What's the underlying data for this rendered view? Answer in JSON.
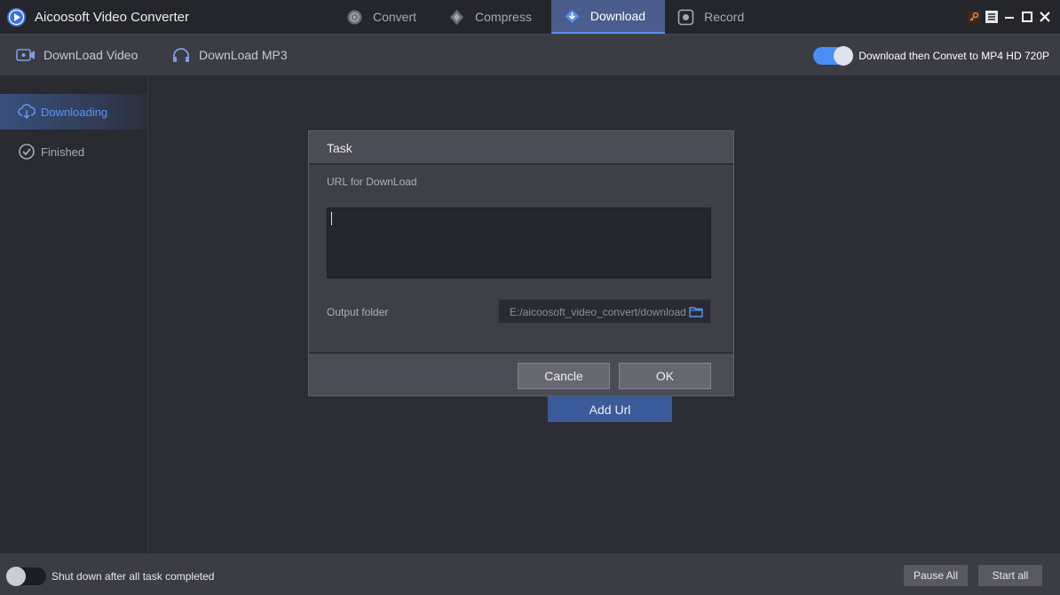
{
  "app": {
    "title": "Aicoosoft Video Converter",
    "accent": "#4a8df5"
  },
  "top_tabs": [
    {
      "label": "Convert",
      "icon": "convert-icon",
      "active": false
    },
    {
      "label": "Compress",
      "icon": "compress-icon",
      "active": false
    },
    {
      "label": "Download",
      "icon": "download-icon",
      "active": true
    },
    {
      "label": "Record",
      "icon": "record-icon",
      "active": false
    }
  ],
  "window_controls": {
    "icons": [
      "key-icon",
      "menu-icon",
      "minimize-icon",
      "maximize-icon",
      "close-icon"
    ]
  },
  "subbar": {
    "download_video": "DownLoad Video",
    "download_mp3": "DownLoad MP3",
    "convert_toggle_label": "Download then Convet to MP4 HD 720P",
    "convert_toggle_on": true
  },
  "sidebar": {
    "items": [
      {
        "label": "Downloading",
        "icon": "cloud-download-icon",
        "active": true
      },
      {
        "label": "Finished",
        "icon": "check-circle-icon",
        "active": false
      }
    ]
  },
  "dialog": {
    "title": "Task",
    "url_label": "URL for DownLoad",
    "url_value": "",
    "output_label": "Output folder",
    "output_value": "E:/aicoosoft_video_convert/download",
    "cancel_label": "Cancle",
    "ok_label": "OK"
  },
  "main": {
    "add_url_label": "Add Url"
  },
  "bottombar": {
    "shutdown_label": "Shut down after all task completed",
    "shutdown_on": false,
    "pause_all_label": "Pause All",
    "start_all_label": "Start all"
  }
}
